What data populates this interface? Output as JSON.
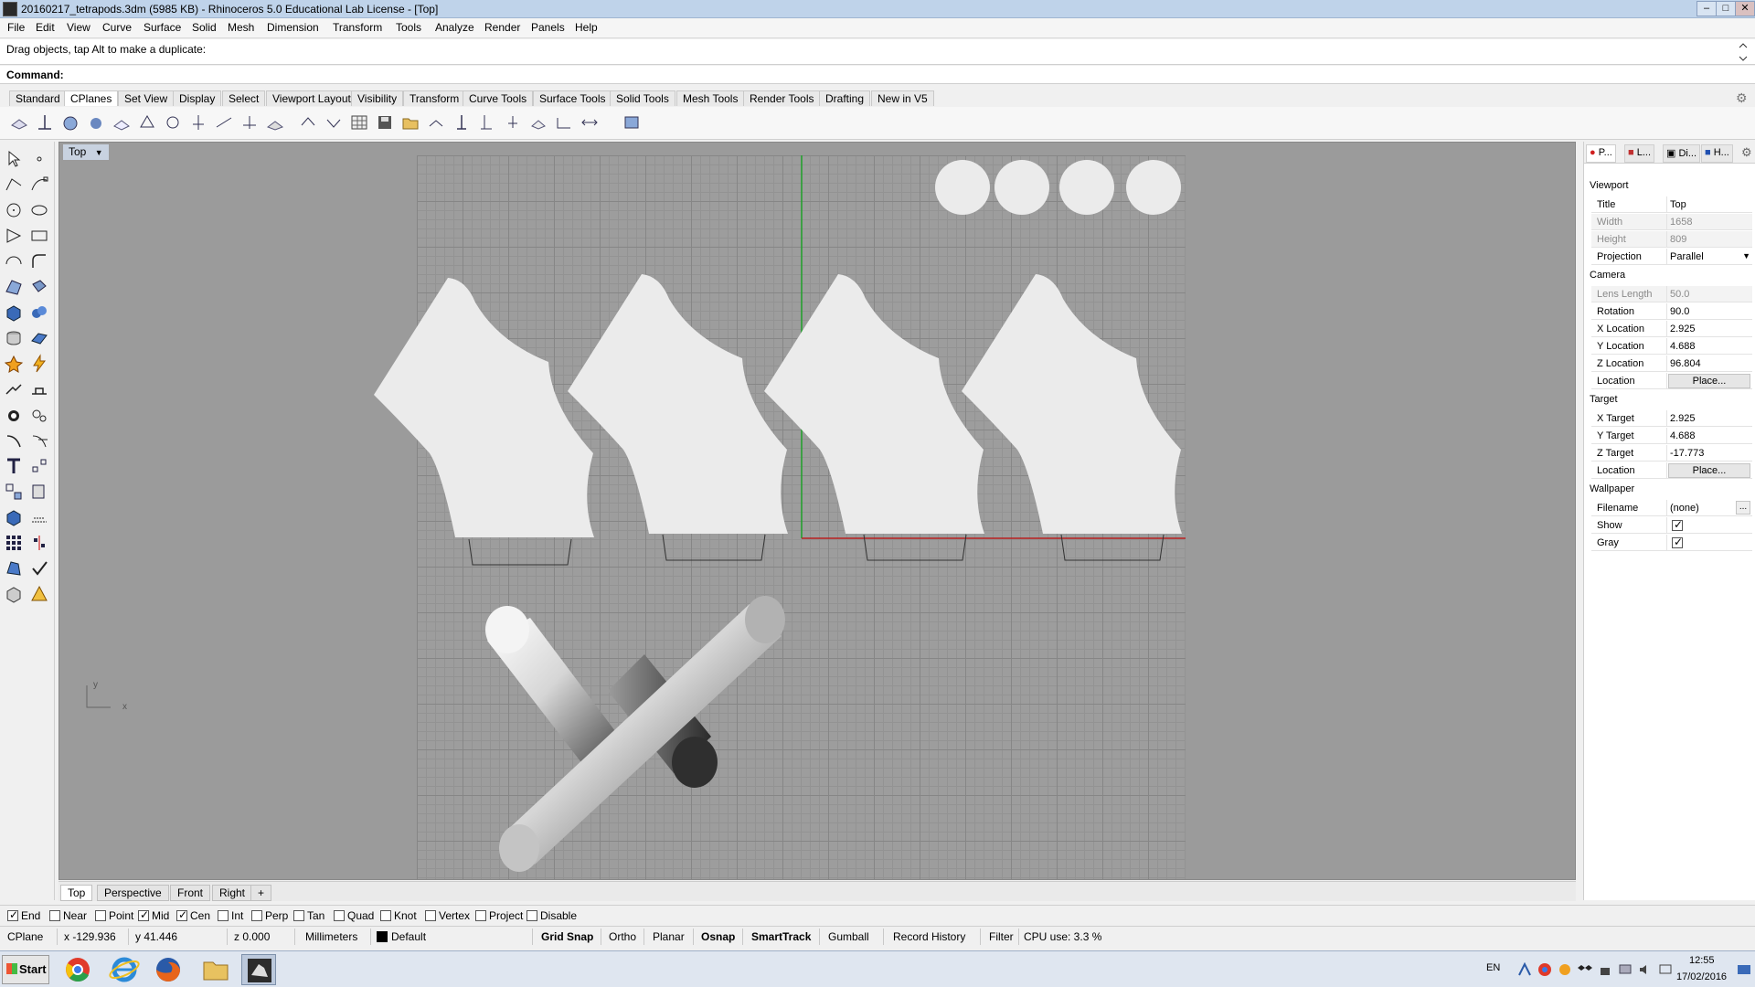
{
  "window": {
    "title": "20160217_tetrapods.3dm (5985 KB) - Rhinoceros 5.0 Educational Lab License - [Top]",
    "minimize": "–",
    "maximize": "□",
    "close": "✕"
  },
  "menu": [
    "File",
    "Edit",
    "View",
    "Curve",
    "Surface",
    "Solid",
    "Mesh",
    "Dimension",
    "Transform",
    "Tools",
    "Analyze",
    "Render",
    "Panels",
    "Help"
  ],
  "command": {
    "history": "Drag objects, tap Alt to make a duplicate:",
    "label": "Command:",
    "value": ""
  },
  "toolbar_tabs": [
    "Standard",
    "CPlanes",
    "Set View",
    "Display",
    "Select",
    "Viewport Layout",
    "Visibility",
    "Transform",
    "Curve Tools",
    "Surface Tools",
    "Solid Tools",
    "Mesh Tools",
    "Render Tools",
    "Drafting",
    "New in V5"
  ],
  "active_toolbar_tab": "CPlanes",
  "viewport": {
    "title": "Top",
    "axis_y": "y",
    "axis_x": "x"
  },
  "viewport_tabs": [
    "Top",
    "Perspective",
    "Front",
    "Right",
    "+"
  ],
  "osnap": {
    "items": [
      {
        "label": "End",
        "checked": true
      },
      {
        "label": "Near",
        "checked": false
      },
      {
        "label": "Point",
        "checked": false
      },
      {
        "label": "Mid",
        "checked": true
      },
      {
        "label": "Cen",
        "checked": true
      },
      {
        "label": "Int",
        "checked": false
      },
      {
        "label": "Perp",
        "checked": false
      },
      {
        "label": "Tan",
        "checked": false
      },
      {
        "label": "Quad",
        "checked": false
      },
      {
        "label": "Knot",
        "checked": false
      },
      {
        "label": "Vertex",
        "checked": false
      },
      {
        "label": "Project",
        "checked": false
      },
      {
        "label": "Disable",
        "checked": false
      }
    ]
  },
  "status": {
    "cplane": "CPlane",
    "x": "x -129.936",
    "y": "y 41.446",
    "z": "z 0.000",
    "units": "Millimeters",
    "layer": "Default",
    "grid_snap": "Grid Snap",
    "ortho": "Ortho",
    "planar": "Planar",
    "osnap": "Osnap",
    "smarttrack": "SmartTrack",
    "gumball": "Gumball",
    "record_history": "Record History",
    "filter": "Filter",
    "cpu": "CPU use: 3.3 %"
  },
  "panel": {
    "tabs": [
      "P...",
      "L...",
      "Di...",
      "H..."
    ],
    "sections": {
      "viewport": "Viewport",
      "camera": "Camera",
      "target": "Target",
      "wallpaper": "Wallpaper"
    },
    "viewport_rows": [
      {
        "k": "Title",
        "v": "Top"
      },
      {
        "k": "Width",
        "v": "1658"
      },
      {
        "k": "Height",
        "v": "809"
      },
      {
        "k": "Projection",
        "v": "Parallel"
      }
    ],
    "camera_rows": [
      {
        "k": "Lens Length",
        "v": "50.0"
      },
      {
        "k": "Rotation",
        "v": "90.0"
      },
      {
        "k": "X Location",
        "v": "2.925"
      },
      {
        "k": "Y Location",
        "v": "4.688"
      },
      {
        "k": "Z Location",
        "v": "96.804"
      },
      {
        "k": "Location",
        "v": "Place..."
      }
    ],
    "target_rows": [
      {
        "k": "X Target",
        "v": "2.925"
      },
      {
        "k": "Y Target",
        "v": "4.688"
      },
      {
        "k": "Z Target",
        "v": "-17.773"
      },
      {
        "k": "Location",
        "v": "Place..."
      }
    ],
    "wallpaper_rows": [
      {
        "k": "Filename",
        "v": "(none)"
      },
      {
        "k": "Show",
        "v": ""
      },
      {
        "k": "Gray",
        "v": ""
      }
    ],
    "filename_btn": "..."
  },
  "taskbar": {
    "start": "Start",
    "lang": "EN",
    "time": "12:55",
    "date": "17/02/2016"
  }
}
